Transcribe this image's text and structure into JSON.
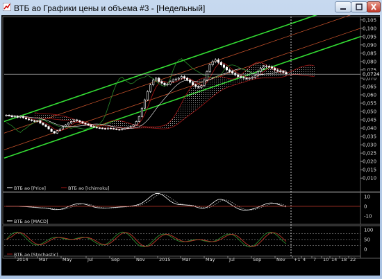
{
  "window": {
    "title": "ВТБ ао Графики цены и объема #3 - [Недельный]"
  },
  "colors": {
    "background": "#000000",
    "price_up": "#ffffff",
    "price_down": "#ffffff",
    "ichimoku": "#a31515",
    "channel": "#33dd33",
    "inner_channel": "#c0502a",
    "macd": "#ffffff",
    "stoch_k": "#2e8b2e",
    "stoch_d": "#c0392b"
  },
  "main_panel": {
    "y_ticks": [
      "0,105",
      "0,100",
      "0,095",
      "0,090",
      "0,085",
      "0,080",
      "0,075",
      "0,070",
      "0,065",
      "0,060",
      "0,055",
      "0,050",
      "0,045",
      "0,040",
      "0,035",
      "0,030",
      "0,025",
      "0,020",
      "0,015",
      "0,010"
    ],
    "current_price_label": "0,07243",
    "legend": [
      {
        "label": "ВТБ ао [Price]",
        "color": "#ffffff"
      },
      {
        "label": "ВТБ ао [Ichimoku]",
        "color": "#a31515"
      }
    ]
  },
  "macd_panel": {
    "y_ticks": [
      "10",
      "0",
      "-10"
    ],
    "legend": {
      "label": "ВТБ ао [MACD]",
      "color": "#ffffff"
    }
  },
  "stoch_panel": {
    "y_ticks": [
      "100",
      "50",
      "0"
    ],
    "legend": {
      "label": "ВТБ ао [Stochastic]",
      "color": "#a31515"
    }
  },
  "time_axis": {
    "labels": [
      "2014",
      "Mar",
      "May",
      "Jul",
      "Sep",
      "Nov",
      "2015",
      "Mar",
      "May",
      "Jul",
      "Sep",
      "Nov",
      "+1",
      "4",
      "7",
      "10",
      "14",
      "18",
      "22"
    ]
  },
  "chart_data": {
    "type": "candlestick",
    "timeframe": "Недельный",
    "ylim": [
      0.008,
      0.107
    ],
    "close": [
      0.0478,
      0.0475,
      0.0468,
      0.0472,
      0.0465,
      0.047,
      0.0462,
      0.0455,
      0.045,
      0.0445,
      0.044,
      0.0445,
      0.043,
      0.042,
      0.041,
      0.0395,
      0.038,
      0.037,
      0.0385,
      0.0395,
      0.041,
      0.042,
      0.043,
      0.044,
      0.045,
      0.0445,
      0.0438,
      0.043,
      0.0425,
      0.0418,
      0.041,
      0.0405,
      0.0402,
      0.04,
      0.0398,
      0.0395,
      0.04,
      0.0398,
      0.0395,
      0.0392,
      0.039,
      0.0395,
      0.04,
      0.0405,
      0.041,
      0.042,
      0.044,
      0.047,
      0.052,
      0.057,
      0.062,
      0.066,
      0.069,
      0.07,
      0.068,
      0.067,
      0.066,
      0.0665,
      0.068,
      0.069,
      0.0695,
      0.07,
      0.071,
      0.07,
      0.069,
      0.0675,
      0.066,
      0.065,
      0.0645,
      0.0655,
      0.069,
      0.074,
      0.078,
      0.08,
      0.081,
      0.0795,
      0.078,
      0.0765,
      0.075,
      0.074,
      0.073,
      0.072,
      0.071,
      0.0705,
      0.07,
      0.0698,
      0.07,
      0.0705,
      0.0715,
      0.074,
      0.076,
      0.077,
      0.0772,
      0.0768,
      0.076,
      0.075,
      0.0745,
      0.074,
      0.0735,
      0.0724
    ]
  }
}
